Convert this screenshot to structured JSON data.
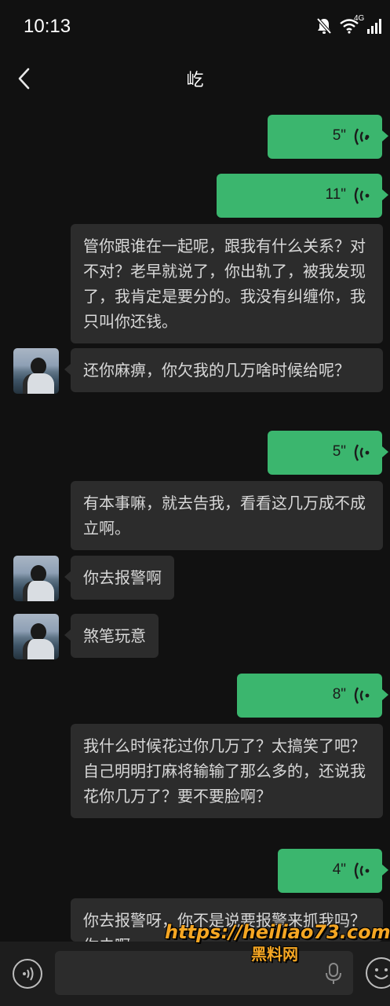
{
  "status_bar": {
    "time": "10:13",
    "network_label": "4G",
    "icons": [
      "bell-muted-icon",
      "wifi-icon",
      "signal-icon"
    ]
  },
  "header": {
    "title": "屹",
    "back_icon": "chevron-left-icon"
  },
  "messages": [
    {
      "side": "right",
      "type": "voice",
      "duration": "5\""
    },
    {
      "side": "right",
      "type": "voice",
      "duration": "11\""
    },
    {
      "side": "left",
      "type": "text",
      "text": "管你跟谁在一起呢，跟我有什么关系？对不对？老早就说了，你出轨了，被我发现了，我肯定是要分的。我没有纠缠你，我只叫你还钱。"
    },
    {
      "side": "left",
      "type": "text",
      "text": "还你麻痹，你欠我的几万啥时候给呢？"
    },
    {
      "side": "right",
      "type": "voice",
      "duration": "5\""
    },
    {
      "side": "left",
      "type": "text",
      "text": "有本事嘛，就去告我，看看这几万成不成立啊。"
    },
    {
      "side": "left",
      "type": "text",
      "text": "你去报警啊"
    },
    {
      "side": "left",
      "type": "text",
      "text": "煞笔玩意"
    },
    {
      "side": "right",
      "type": "voice",
      "duration": "8\""
    },
    {
      "side": "left",
      "type": "text",
      "text": "我什么时候花过你几万了？太搞笑了吧？自己明明打麻将输输了那么多的，还说我花你几万了？要不要脸啊？"
    },
    {
      "side": "right",
      "type": "voice",
      "duration": "4\""
    },
    {
      "side": "left",
      "type": "text",
      "text": "你去报警呀，你不是说要报警来抓我吗？你去啊"
    }
  ],
  "input_bar": {
    "placeholder": "",
    "icons": [
      "voice-toggle-icon",
      "mic-icon",
      "emoji-icon"
    ]
  },
  "watermark": {
    "url": "https://heiliao73.com",
    "text": "黑料网"
  },
  "colors": {
    "background": "#111111",
    "outgoing_bubble": "#3bb66e",
    "incoming_bubble": "#2c2c2c",
    "watermark": "#f5a623"
  }
}
